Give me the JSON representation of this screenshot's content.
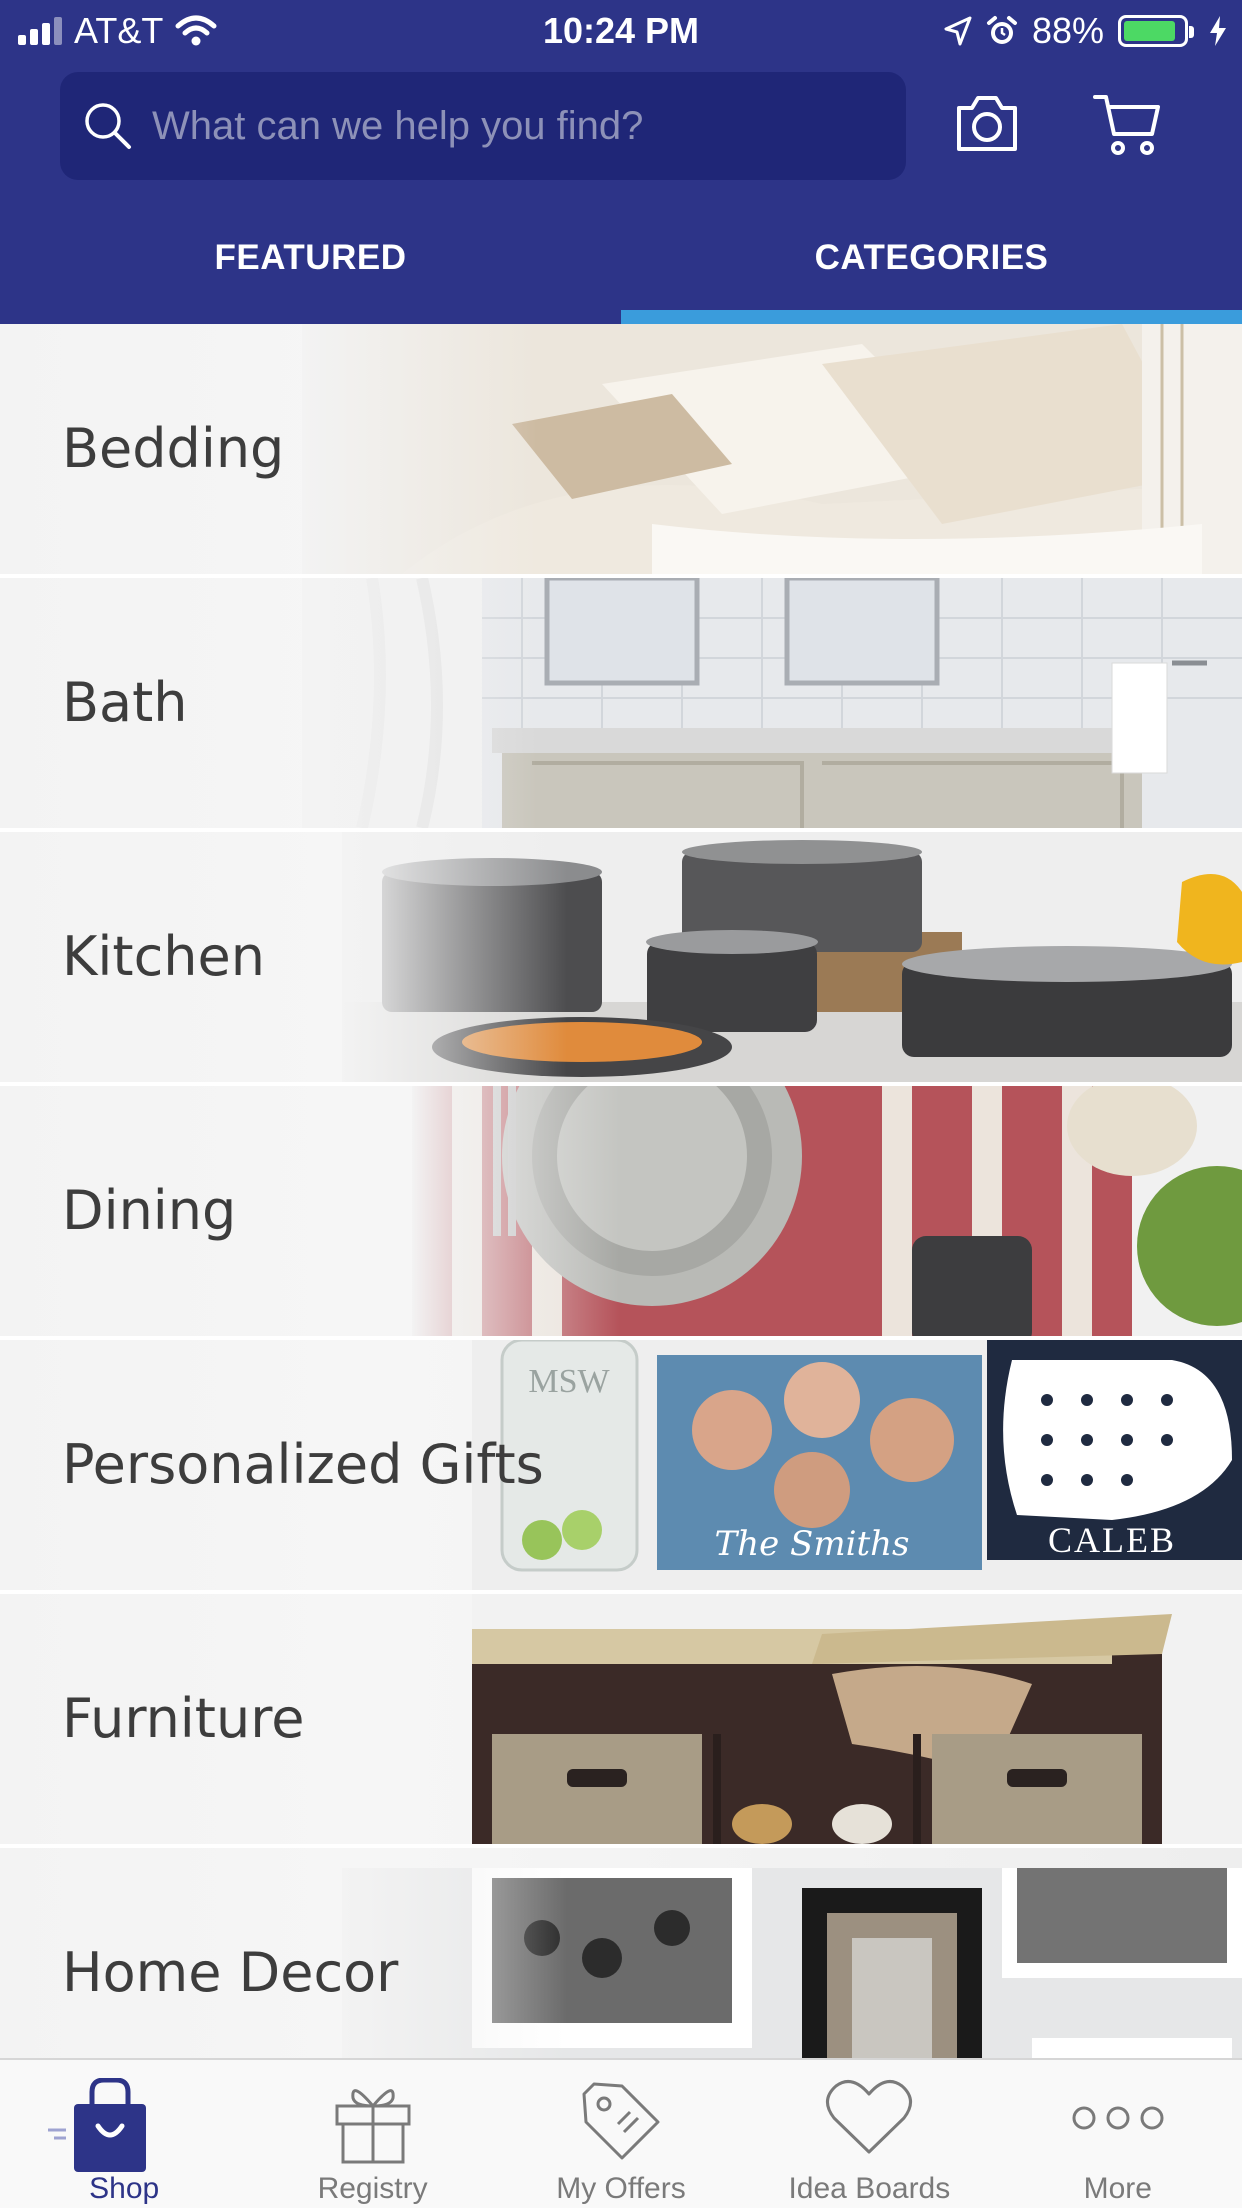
{
  "status_bar": {
    "carrier": "AT&T",
    "time": "10:24 PM",
    "battery": "88%",
    "battery_level": 0.88,
    "icons": [
      "signal-icon",
      "wifi-icon",
      "location-icon",
      "alarm-icon",
      "battery-icon",
      "charging-icon"
    ]
  },
  "search": {
    "placeholder": "What can we help you find?",
    "value": ""
  },
  "header_icons": [
    "camera-icon",
    "cart-icon"
  ],
  "tabs": [
    {
      "label": "FEATURED",
      "active": false
    },
    {
      "label": "CATEGORIES",
      "active": true
    }
  ],
  "categories": [
    {
      "label": "Bedding"
    },
    {
      "label": "Bath"
    },
    {
      "label": "Kitchen"
    },
    {
      "label": "Dining"
    },
    {
      "label": "Personalized Gifts",
      "image_text": [
        "MSW",
        "The Smiths",
        "CALEB"
      ]
    },
    {
      "label": "Furniture"
    },
    {
      "label": "Home Decor"
    }
  ],
  "bottom_nav": [
    {
      "label": "Shop",
      "icon": "shopping-bag-icon",
      "active": true
    },
    {
      "label": "Registry",
      "icon": "gift-icon",
      "active": false
    },
    {
      "label": "My Offers",
      "icon": "tag-icon",
      "active": false
    },
    {
      "label": "Idea Boards",
      "icon": "heart-icon",
      "active": false
    },
    {
      "label": "More",
      "icon": "more-dots-icon",
      "active": false
    }
  ],
  "colors": {
    "header_bg": "#2d3488",
    "search_bg": "#1f2677",
    "tab_indicator": "#3a9cdc",
    "active_nav": "#2d3488",
    "inactive_nav": "#7a7a7a"
  }
}
